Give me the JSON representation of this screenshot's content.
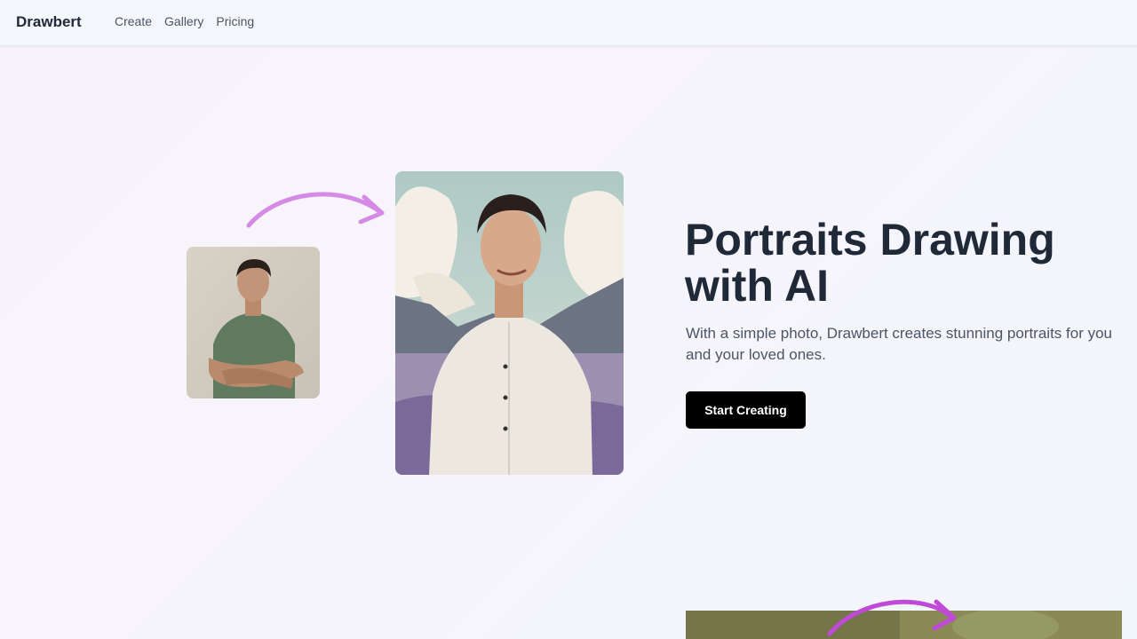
{
  "nav": {
    "brand": "Drawbert",
    "links": [
      "Create",
      "Gallery",
      "Pricing"
    ]
  },
  "hero": {
    "title": "Portraits Drawing with AI",
    "subtitle": "With a simple photo, Drawbert creates stunning portraits for you and your loved ones.",
    "cta_label": "Start Creating"
  },
  "colors": {
    "accent_arrow": "#d58be6",
    "accent_arrow_bottom": "#c04ad8",
    "cta_bg": "#000000",
    "title": "#1f2937"
  },
  "icons": {
    "transform_arrow": "curved-arrow-icon"
  }
}
